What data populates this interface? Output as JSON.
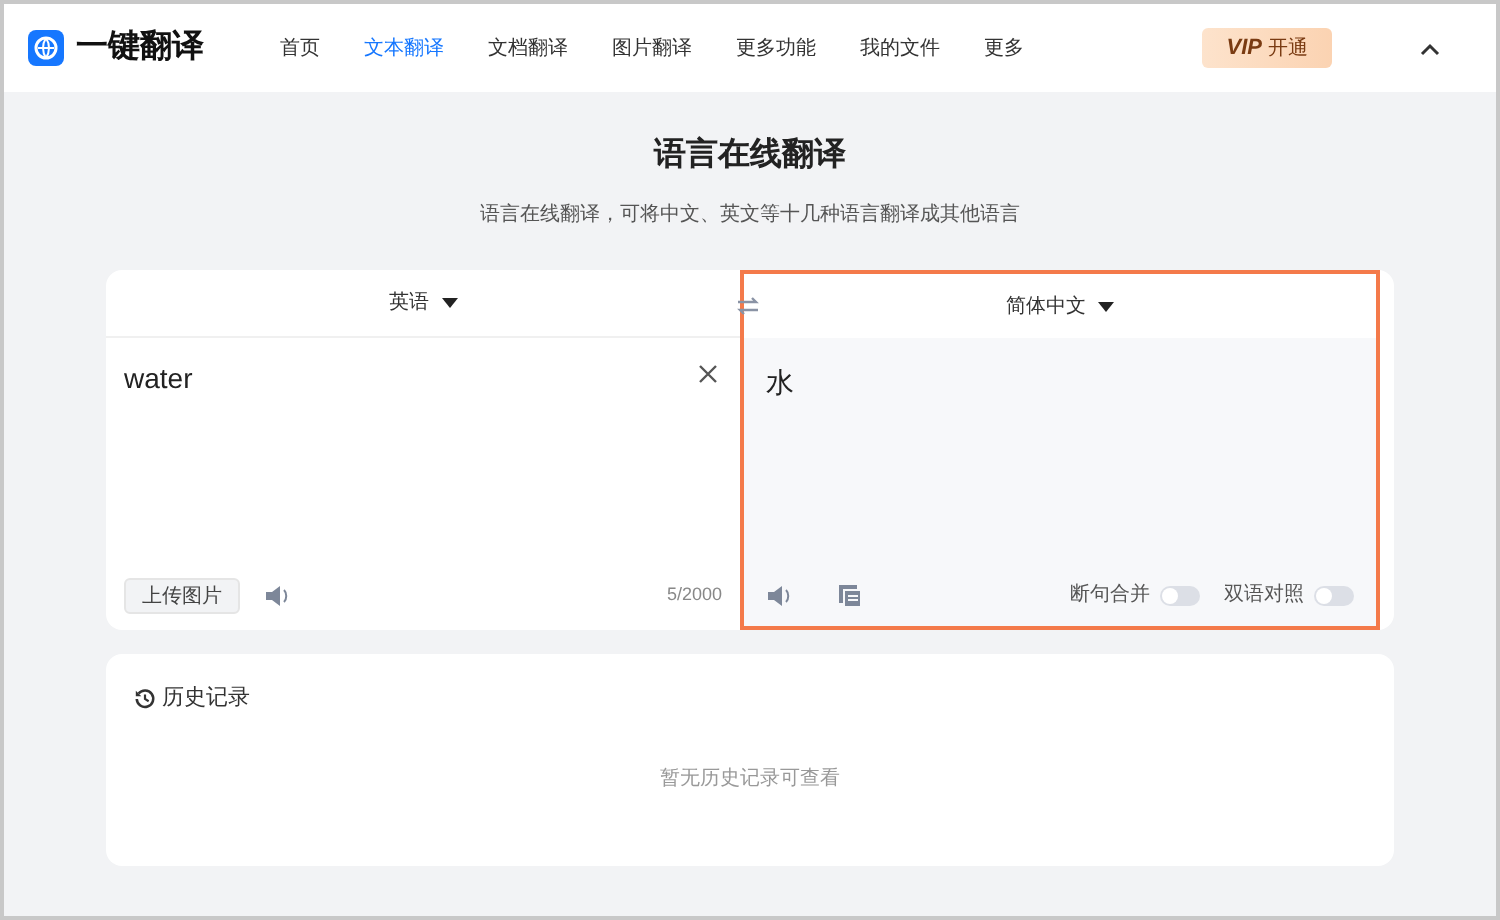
{
  "header": {
    "logo": "一键翻译",
    "nav": [
      {
        "label": "首页",
        "selected": false
      },
      {
        "label": "文本翻译",
        "selected": true
      },
      {
        "label": "文档翻译",
        "selected": false
      },
      {
        "label": "图片翻译",
        "selected": false
      },
      {
        "label": "更多功能",
        "selected": false
      },
      {
        "label": "我的文件",
        "selected": false
      },
      {
        "label": "更多",
        "selected": false
      }
    ],
    "vip": {
      "badge": "VIP",
      "label": "开通"
    }
  },
  "title": "语言在线翻译",
  "subtitle": "语言在线翻译，可将中文、英文等十几种语言翻译成其他语言",
  "source": {
    "language": "英语",
    "text": "water",
    "upload_button": "上传图片",
    "count": "5/2000"
  },
  "target": {
    "language": "简体中文",
    "text": "水",
    "toggles": [
      {
        "label": "断句合并",
        "on": false
      },
      {
        "label": "双语对照",
        "on": false
      }
    ]
  },
  "history": {
    "title": "历史记录",
    "empty": "暂无历史记录可查看"
  }
}
